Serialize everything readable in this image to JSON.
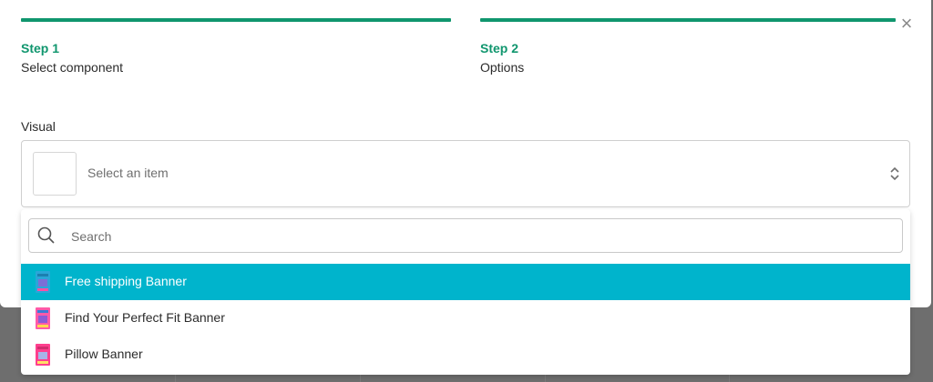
{
  "steps": [
    {
      "number": "Step 1",
      "name": "Select component"
    },
    {
      "number": "Step 2",
      "name": "Options"
    }
  ],
  "close_icon": "×",
  "visual": {
    "label": "Visual",
    "placeholder": "Select an item"
  },
  "search": {
    "placeholder": "Search"
  },
  "options": [
    {
      "label": "Free shipping Banner",
      "selected": true
    },
    {
      "label": "Find Your Perfect Fit Banner",
      "selected": false
    },
    {
      "label": "Pillow Banner",
      "selected": false
    }
  ],
  "colors": {
    "accent": "#10966e",
    "highlight": "#00b4cc"
  }
}
